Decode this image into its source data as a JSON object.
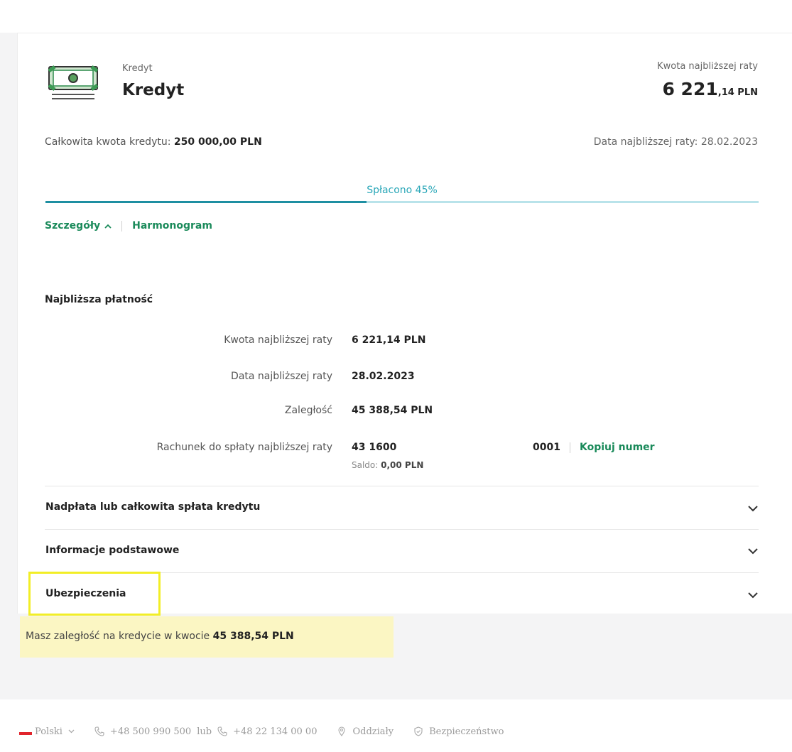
{
  "product": {
    "category": "Kredyt",
    "name": "Kredyt",
    "icon": "banknote-icon"
  },
  "next_installment": {
    "label": "Kwota najbliższej raty",
    "amount_main": "6 221",
    "amount_fraction": ",14 PLN"
  },
  "summary": {
    "total_label": "Całkowita kwota kredytu:",
    "total_value": "250 000,00 PLN",
    "next_date_label": "Data najbliższej raty:",
    "next_date_value": "28.02.2023"
  },
  "progress": {
    "label": "Spłacono 45%",
    "fraction": 0.45
  },
  "tabs": {
    "details": "Szczegóły",
    "schedule": "Harmonogram"
  },
  "next_payment": {
    "title": "Najbliższa płatność",
    "rows": [
      {
        "label": "Kwota najbliższej raty",
        "value": "6 221,14 PLN"
      },
      {
        "label": "Data najbliższej raty",
        "value": "28.02.2023"
      },
      {
        "label": "Zaległość",
        "value": "45 388,54 PLN"
      },
      {
        "label": "Rachunek do spłaty najbliższej raty",
        "value": "43 1600"
      }
    ],
    "account_tail": "0001",
    "copy_label": "Kopiuj numer",
    "saldo_label": "Saldo:",
    "saldo_value": "0,00 PLN"
  },
  "accordion": [
    {
      "title": "Nadpłata lub całkowita spłata kredytu"
    },
    {
      "title": "Informacje podstawowe"
    },
    {
      "title": "Ubezpieczenia"
    }
  ],
  "alert": {
    "text": "Masz zaległość na kredycie w kwocie",
    "amount": "45 388,54 PLN"
  },
  "footer": {
    "language": "Polski",
    "phone1": "+48 500 990 500",
    "or": "lub",
    "phone2": "+48 22 134 00 00",
    "branches": "Oddziały",
    "security": "Bezpieczeństwo"
  },
  "colors": {
    "accent_green": "#1a8a5a",
    "progress_teal": "#1e8fa2",
    "alert_bg": "#fbf6c3",
    "highlight": "#f2ee26"
  }
}
